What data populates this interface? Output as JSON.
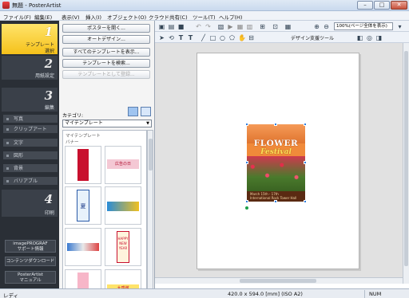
{
  "window": {
    "title": "無題 - PosterArtist",
    "minimize_icon": "minimize-icon",
    "maximize_icon": "maximize-icon",
    "close_icon": "close-icon"
  },
  "menu": [
    "ファイル(F)",
    "編集(E)",
    "表示(V)",
    "挿入(I)",
    "オブジェクト(O)",
    "クラウド共有(C)",
    "ツール(T)",
    "ヘルプ(H)"
  ],
  "nav": {
    "steps": [
      {
        "num": "1",
        "label_line1": "テンプレート",
        "label_line2": "選択",
        "active": true
      },
      {
        "num": "2",
        "label_line1": "用紙設定",
        "label_line2": ""
      },
      {
        "num": "3",
        "label_line1": "編集",
        "label_line2": ""
      },
      {
        "num": "4",
        "label_line1": "印刷",
        "label_line2": ""
      }
    ],
    "edit_items": [
      "写真",
      "クリップアート",
      "文字",
      "図形",
      "背景",
      "バリアブル"
    ],
    "bottom_buttons": [
      {
        "line1": "imagePROGRAF",
        "line2": "サポート情報"
      },
      {
        "line1": "コンテンツダウンロード",
        "line2": ""
      },
      {
        "line1": "PosterArtist",
        "line2": "マニュアル"
      }
    ]
  },
  "panel": {
    "buttons": [
      "ポスターを開く...",
      "オートデザイン...",
      "すべてのテンプレートを表示...",
      "テンプレートを検索...",
      "テンプレートとして登録..."
    ],
    "category_label": "カテゴリ:",
    "category_value": "マイテンプレート",
    "crumb1": "マイテンプレート",
    "crumb2": "バナー",
    "thumbnails": [
      {
        "text": ""
      },
      {
        "text": "広告の日"
      },
      {
        "text": "夏"
      },
      {
        "text": ""
      },
      {
        "text": ""
      },
      {
        "text": "HAPPY NEW YEAR"
      },
      {
        "text": ""
      },
      {
        "text": "大感謝"
      }
    ]
  },
  "toolbar": {
    "zoom": "100%(ページ全体を表示)",
    "design_support": "デザイン支援ツール"
  },
  "poster": {
    "title": "FLOWER",
    "subtitle": "Festival",
    "line1": "March 15th - 17th",
    "line2": "International Rock Tower Hall"
  },
  "status": {
    "ready": "レディ",
    "size": "420.0 x 594.0 [mm] (ISO A2)",
    "num": "NUM"
  },
  "colors": {
    "nav_active": "#f5c11a",
    "nav_bg": "#2a2f36",
    "selection": "#2f7fe0"
  }
}
